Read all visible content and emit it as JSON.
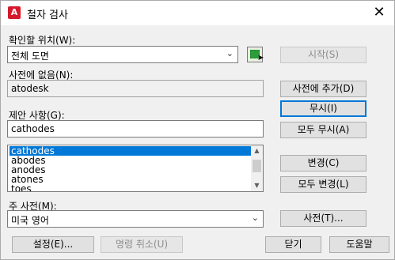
{
  "window": {
    "title": "철자 검사",
    "app_icon_text": "A",
    "close_glyph": "✕"
  },
  "location": {
    "label": "확인할 위치(W):",
    "value": "전체 도면",
    "arrow": "⌄"
  },
  "not_in_dictionary": {
    "label": "사전에 없음(N):",
    "value": "atodesk"
  },
  "suggestions": {
    "label": "제안 사항(G):",
    "value": "cathodes",
    "items": [
      "cathodes",
      "abodes",
      "anodes",
      "atones",
      "toes"
    ],
    "selected_index": 0
  },
  "main_dictionary": {
    "label": "주 사전(M):",
    "value": "미국 영어",
    "arrow": "⌄"
  },
  "buttons": {
    "start": "시작(S)",
    "add_to_dictionary": "사전에 추가(D)",
    "ignore": "무시(I)",
    "ignore_all": "모두 무시(A)",
    "change": "변경(C)",
    "change_all": "모두 변경(L)",
    "dictionaries": "사전(T)...",
    "settings": "설정(E)...",
    "undo": "명령 취소(U)",
    "close": "닫기",
    "help": "도움말"
  },
  "scroll": {
    "up": "▲",
    "down": "▼"
  }
}
